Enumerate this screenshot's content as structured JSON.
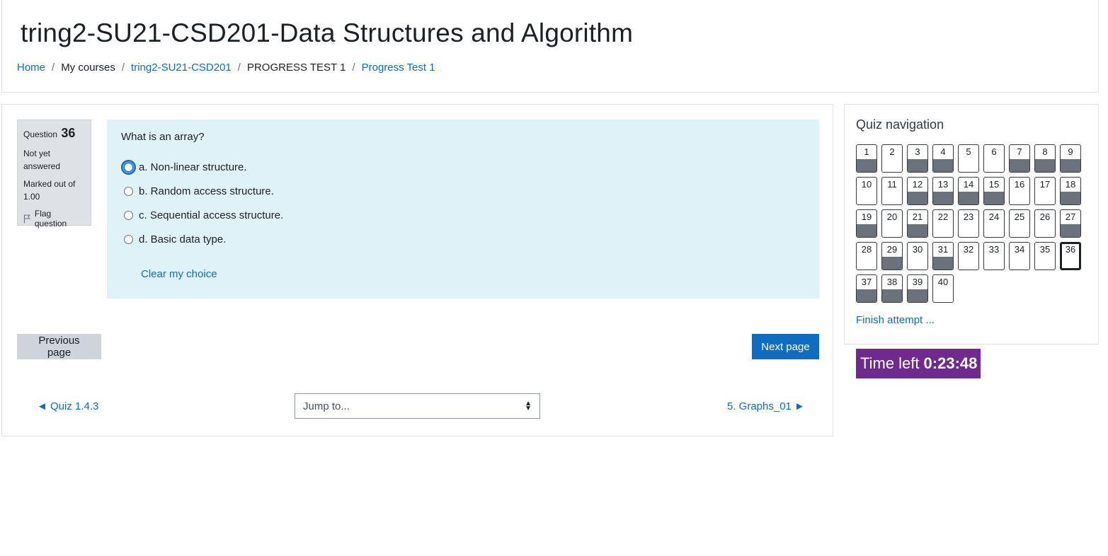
{
  "header": {
    "title": "tring2-SU21-CSD201-Data Structures and Algorithm",
    "breadcrumb": [
      {
        "label": "Home",
        "link": true
      },
      {
        "label": "My courses",
        "link": false
      },
      {
        "label": "tring2-SU21-CSD201",
        "link": true
      },
      {
        "label": "PROGRESS TEST 1",
        "link": false
      },
      {
        "label": "Progress Test 1",
        "link": true
      }
    ]
  },
  "question": {
    "label": "Question",
    "number": "36",
    "state": "Not yet answered",
    "grade": "Marked out of 1.00",
    "flag_label": "Flag question",
    "text": "What is an array?",
    "answers": [
      {
        "label": "a. Non-linear structure.",
        "focused": true
      },
      {
        "label": "b. Random access structure.",
        "focused": false
      },
      {
        "label": "c. Sequential access structure.",
        "focused": false
      },
      {
        "label": "d. Basic data type.",
        "focused": false
      }
    ],
    "clear_choice": "Clear my choice"
  },
  "buttons": {
    "previous": "Previous page",
    "next": "Next page"
  },
  "activity_nav": {
    "prev": "◄ Quiz 1.4.3",
    "jump_placeholder": "Jump to...",
    "next": "5. Graphs_01 ►"
  },
  "quiz_nav": {
    "title": "Quiz navigation",
    "questions": [
      {
        "n": "1",
        "answered": true
      },
      {
        "n": "2",
        "answered": false
      },
      {
        "n": "3",
        "answered": true
      },
      {
        "n": "4",
        "answered": true
      },
      {
        "n": "5",
        "answered": false
      },
      {
        "n": "6",
        "answered": false
      },
      {
        "n": "7",
        "answered": true
      },
      {
        "n": "8",
        "answered": true
      },
      {
        "n": "9",
        "answered": true
      },
      {
        "n": "10",
        "answered": false
      },
      {
        "n": "11",
        "answered": false
      },
      {
        "n": "12",
        "answered": true
      },
      {
        "n": "13",
        "answered": true
      },
      {
        "n": "14",
        "answered": true
      },
      {
        "n": "15",
        "answered": true
      },
      {
        "n": "16",
        "answered": false
      },
      {
        "n": "17",
        "answered": false
      },
      {
        "n": "18",
        "answered": true
      },
      {
        "n": "19",
        "answered": true
      },
      {
        "n": "20",
        "answered": false
      },
      {
        "n": "21",
        "answered": true
      },
      {
        "n": "22",
        "answered": false
      },
      {
        "n": "23",
        "answered": false
      },
      {
        "n": "24",
        "answered": false
      },
      {
        "n": "25",
        "answered": false
      },
      {
        "n": "26",
        "answered": false
      },
      {
        "n": "27",
        "answered": true
      },
      {
        "n": "28",
        "answered": false
      },
      {
        "n": "29",
        "answered": true
      },
      {
        "n": "30",
        "answered": false
      },
      {
        "n": "31",
        "answered": true
      },
      {
        "n": "32",
        "answered": false
      },
      {
        "n": "33",
        "answered": false
      },
      {
        "n": "34",
        "answered": false
      },
      {
        "n": "35",
        "answered": false
      },
      {
        "n": "36",
        "answered": false,
        "current": true
      },
      {
        "n": "37",
        "answered": true
      },
      {
        "n": "38",
        "answered": true
      },
      {
        "n": "39",
        "answered": true
      },
      {
        "n": "40",
        "answered": false
      }
    ],
    "finish": "Finish attempt ..."
  },
  "timer": {
    "label": "Time left",
    "value": "0:23:48"
  },
  "colors": {
    "link": "#0f6cbf",
    "question_bg": "#def2f8",
    "answered_fill": "#6a737b",
    "timer_bg": "#6e2b8d",
    "primary_button": "#0f6cbf"
  }
}
